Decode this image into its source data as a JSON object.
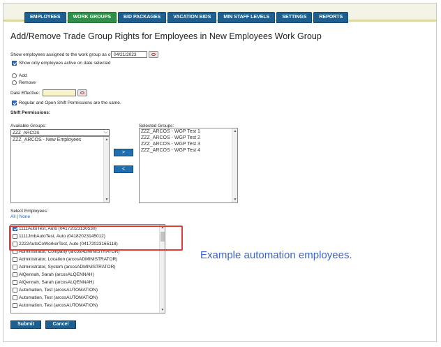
{
  "nav": {
    "tabs": [
      "EMPLOYEES",
      "WORK GROUPS",
      "BID PACKAGES",
      "VACATION BIDS",
      "MIN STAFF LEVELS",
      "SETTINGS",
      "REPORTS"
    ],
    "active_tab": "WORK GROUPS"
  },
  "page": {
    "title": "Add/Remove Trade Group Rights for Employees in New Employees Work Group"
  },
  "form": {
    "as_of_label": "Show employees assigned to the work group as of:",
    "as_of_value": "04/21/2023",
    "active_only_label": "Show only employees active on date selected",
    "active_only_checked": true,
    "add_label": "Add",
    "remove_label": "Remove",
    "date_effective_label": "Date Effective:",
    "date_effective_value": "",
    "regular_open_label": "Regular and Open Shift Permissions are the same.",
    "regular_open_checked": true,
    "shift_permissions_label": "Shift Permissions:",
    "available_groups_label": "Available Groups:",
    "available_groups_dropdown": "ZZZ_ARCOS",
    "available_groups": [
      "ZZZ_ARCOS - New Employees"
    ],
    "selected_groups_label": "Selected Groups:",
    "selected_groups": [
      "ZZZ_ARCOS - WGP Test 1",
      "ZZZ_ARCOS - WGP Test 2",
      "ZZZ_ARCOS - WGP Test 3",
      "ZZZ_ARCOS - WGP Test 4"
    ],
    "move_right_label": ">",
    "move_left_label": "<",
    "select_employees_label": "Select Employees:",
    "all_link": "All",
    "separator": "|",
    "none_link": "None",
    "employees": [
      {
        "name": "1111AutoTest, Auto (04172023130530)",
        "checked": true
      },
      {
        "name": "1111JmbAutoTest, Auto (04182023145012)",
        "checked": false
      },
      {
        "name": "2222AutoCoWorkerTest, Auto (04172023165118)",
        "checked": false
      },
      {
        "name": "Administrator, Company (arcosADMINISTRATOR)",
        "checked": false
      },
      {
        "name": "Administrator, Location (arcosADMINISTRATOR)",
        "checked": false
      },
      {
        "name": "Administrator, System (arcosADMINISTRATOR)",
        "checked": false
      },
      {
        "name": "AlQennah, Sarah (arcosALQENNAH)",
        "checked": false
      },
      {
        "name": "AlQennah, Sarah (arcosALQENNAH)",
        "checked": false
      },
      {
        "name": "Automation, Test (arcosAUTOMATION)",
        "checked": false
      },
      {
        "name": "Automation, Test (arcosAUTOMATION)",
        "checked": false
      },
      {
        "name": "Automation, Test (arcosAUTOMATION)",
        "checked": false
      }
    ],
    "submit_label": "Submit",
    "cancel_label": "Cancel"
  },
  "annotation": {
    "text": "Example automation employees.",
    "highlight_color": "#e23b3b",
    "text_color": "#3b63c9"
  },
  "colors": {
    "nav_tab": "#1f5f8f",
    "nav_tab_active": "#2f8f4a",
    "button": "#1f6fb0"
  },
  "icons": {
    "calendar": "calendar-icon",
    "dropdown": "chevron-down-icon"
  }
}
